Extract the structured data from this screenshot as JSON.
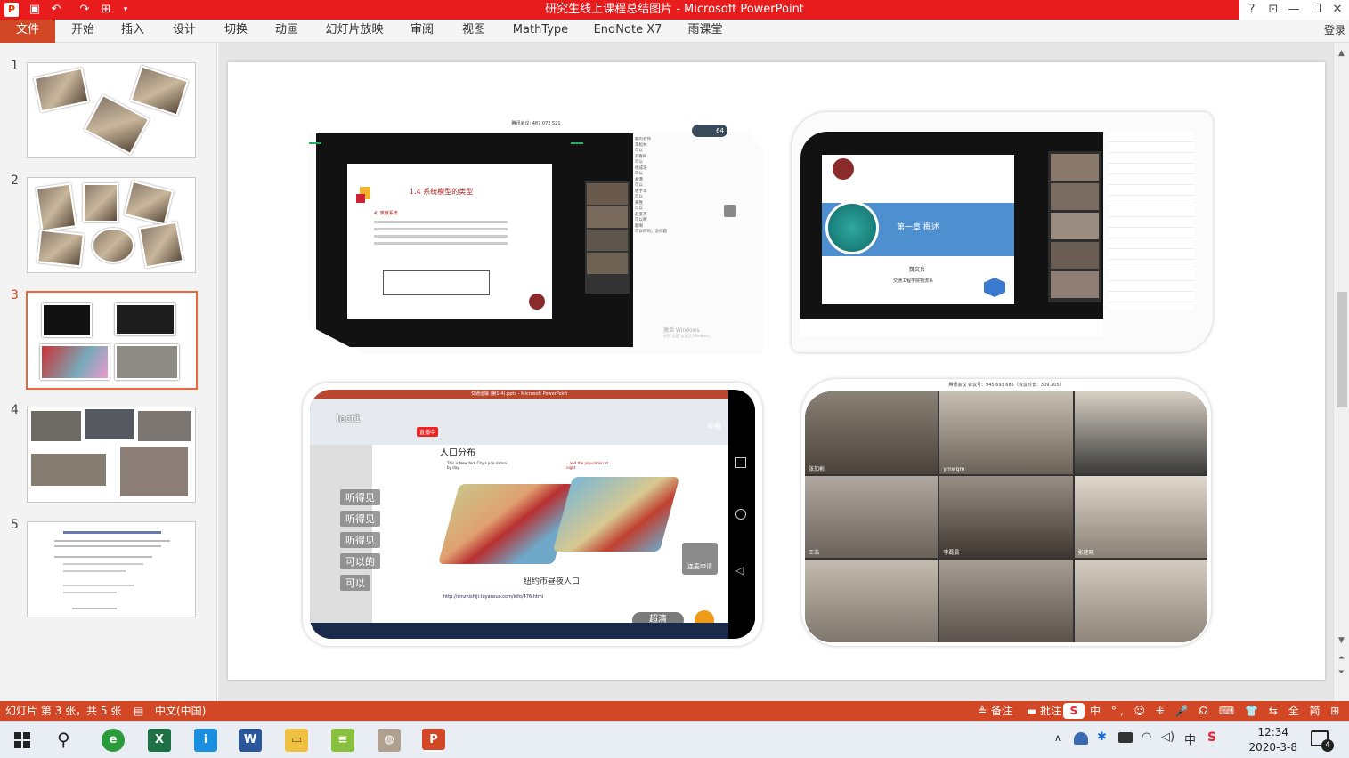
{
  "window": {
    "title": "研究生线上课程总结图片 - Microsoft PowerPoint",
    "help": "?",
    "restore_ribbon": "⊡",
    "minimize": "—",
    "maximize": "❐",
    "close": "✕"
  },
  "ribbon": {
    "tabs": [
      "文件",
      "开始",
      "插入",
      "设计",
      "切换",
      "动画",
      "幻灯片放映",
      "审阅",
      "视图",
      "MathType",
      "EndNote X7",
      "雨课堂"
    ],
    "login": "登录"
  },
  "thumbnails": [
    {
      "number": "1"
    },
    {
      "number": "2"
    },
    {
      "number": "3",
      "selected": true
    },
    {
      "number": "4"
    },
    {
      "number": "5"
    }
  ],
  "slide": {
    "shot1": {
      "meeting_id": "腾讯会议: 487 072 521",
      "heading": "1.4 系统模型的类型",
      "sub": "4) 离散系统",
      "side_list": [
        "能的老师",
        "李松林",
        "可以",
        "刘春梅",
        "可以",
        "杨成浩",
        "可以",
        "胡港",
        "可以",
        "唐宇华",
        "可以",
        "黄胜",
        "可以",
        "赵爱杰",
        "可以啊",
        "能啊",
        "可以听的，没问题"
      ],
      "watermark1": "激活 Windows",
      "watermark2": "转到\"设置\"以激活 Windows。",
      "badge": "64"
    },
    "shot2": {
      "title": "第一章  概述",
      "author": "魏文兵",
      "school": "交通工程学院物流系"
    },
    "shot3": {
      "title_bar": "交通运输 (第1-4).pptx - Microsoft PowerPoint",
      "lecture_label": "lect1",
      "chat": [
        "听得见",
        "听得见",
        "听得见",
        "可以的",
        "可以"
      ],
      "slide_title": "人口分布",
      "map_caption": "纽约市昼夜人口",
      "map_left_label": "This is New York City's population by day",
      "map_right_label": "...and the population at night",
      "url": "http://xinzhishiji.tuyansuo.com/info/476.html",
      "hd_button": "超清",
      "apply_mic": "连麦申请",
      "raise_label": "举报",
      "live_badge": "直播中"
    },
    "shot4": {
      "meeting_header": "腾讯会议 会议号：945 693 685（会议时长：309,305）",
      "names": [
        "张加彬",
        "ymwqm",
        "",
        "王浩",
        "李磊晨",
        "张建晓",
        "",
        "",
        ""
      ]
    }
  },
  "status": {
    "slide_info": "幻灯片 第 3 张，共 5 张",
    "language": "中文(中国)",
    "notes": "备注",
    "comments": "批注",
    "ime": "中 °, ☺ ⁜ 🎤 ☊ ⌨ 👕 ⇆ 全 简 ⊞"
  },
  "taskbar": {
    "time": "12:34",
    "date": "2020-3-8",
    "notification_count": "4"
  },
  "colors": {
    "title_red": "#e81c1c",
    "ppt_orange": "#d24726",
    "selected_border": "#e8683c"
  }
}
